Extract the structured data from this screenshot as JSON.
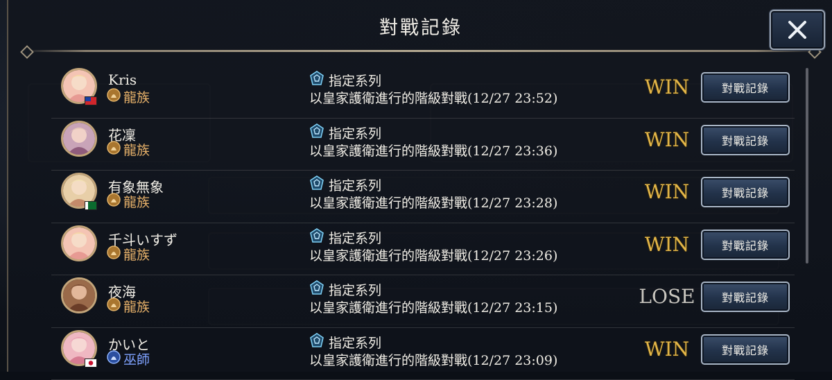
{
  "window": {
    "title": "對戰記錄",
    "close_icon": "close-icon"
  },
  "colors": {
    "win": "#e2b548",
    "lose": "#c9c6bf",
    "dragon_class": "#e8b26a",
    "mage_class": "#7fa2ff"
  },
  "matches": [
    {
      "name": "Kris",
      "flag": "taiwan-flag-icon",
      "class_icon": "dragon-class-icon",
      "class_label": "龍族",
      "mode_icon": "format-icon",
      "mode": "指定系列",
      "description": "以皇家護衛進行的階級對戰(12/27 23:52)",
      "result": "WIN",
      "button_label": "對戰記錄"
    },
    {
      "name": "花凜",
      "flag": "",
      "class_icon": "dragon-class-icon",
      "class_label": "龍族",
      "mode_icon": "format-icon",
      "mode": "指定系列",
      "description": "以皇家護衛進行的階級對戰(12/27 23:36)",
      "result": "WIN",
      "button_label": "對戰記錄"
    },
    {
      "name": "有象無象",
      "flag": "pakistan-flag-icon",
      "class_icon": "dragon-class-icon",
      "class_label": "龍族",
      "mode_icon": "format-icon",
      "mode": "指定系列",
      "description": "以皇家護衛進行的階級對戰(12/27 23:28)",
      "result": "WIN",
      "button_label": "對戰記錄"
    },
    {
      "name": "千斗いすず",
      "flag": "",
      "class_icon": "dragon-class-icon",
      "class_label": "龍族",
      "mode_icon": "format-icon",
      "mode": "指定系列",
      "description": "以皇家護衛進行的階級對戰(12/27 23:26)",
      "result": "WIN",
      "button_label": "對戰記錄"
    },
    {
      "name": "夜海",
      "flag": "",
      "class_icon": "dragon-class-icon",
      "class_label": "龍族",
      "mode_icon": "format-icon",
      "mode": "指定系列",
      "description": "以皇家護衛進行的階級對戰(12/27 23:15)",
      "result": "LOSE",
      "button_label": "對戰記錄"
    },
    {
      "name": "かいと",
      "flag": "japan-flag-icon",
      "class_icon": "mage-class-icon",
      "class_label": "巫師",
      "mode_icon": "format-icon",
      "mode": "指定系列",
      "description": "以皇家護衛進行的階級對戰(12/27 23:09)",
      "result": "WIN",
      "button_label": "對戰記錄"
    }
  ]
}
